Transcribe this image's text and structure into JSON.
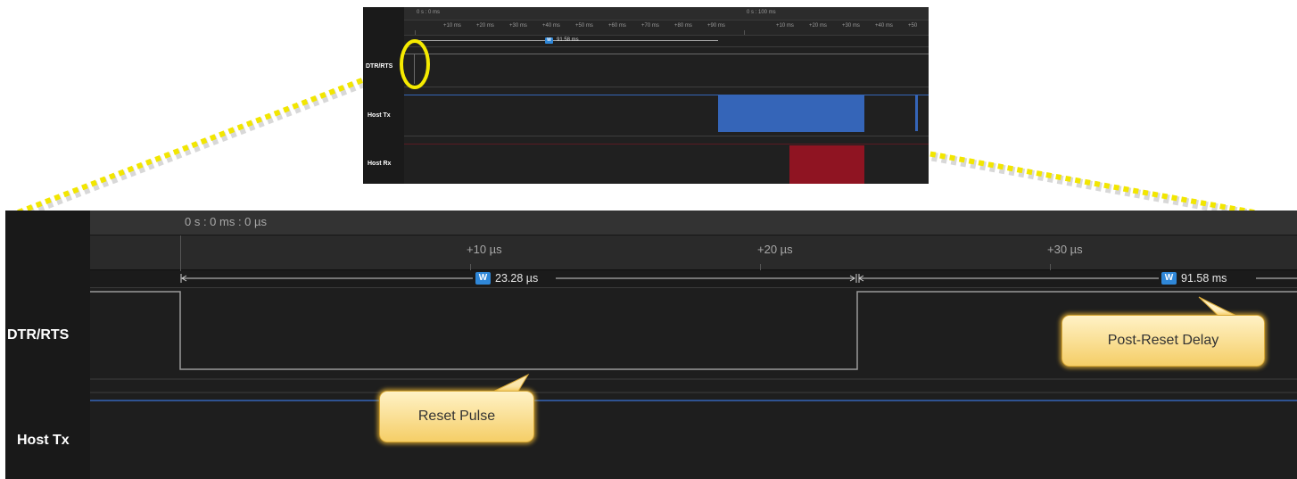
{
  "thumbnail": {
    "time_left": "0 s : 0 ms",
    "time_right": "0 s : 100 ms",
    "ticks": [
      "+10 ms",
      "+20 ms",
      "+30 ms",
      "+40 ms",
      "+50 ms",
      "+60 ms",
      "+70 ms",
      "+80 ms",
      "+90 ms",
      "+10 ms",
      "+20 ms",
      "+30 ms",
      "+40 ms",
      "+50"
    ],
    "measurement": "91.58 ms",
    "badge": "W",
    "rows": [
      "DTR/RTS",
      "Host Tx",
      "Host Rx"
    ]
  },
  "zoom": {
    "time_origin": "0 s : 0 ms : 0 µs",
    "ticks": [
      "+10 µs",
      "+20 µs",
      "+30 µs"
    ],
    "measurement_1": "23.28 µs",
    "measurement_2": "91.58 ms",
    "badge": "W",
    "rows": [
      "DTR/RTS",
      "Host Tx"
    ]
  },
  "callouts": {
    "reset_pulse": "Reset Pulse",
    "post_reset_delay": "Post-Reset Delay"
  },
  "colors": {
    "host_tx": "#3565b8",
    "host_rx": "#8f1422",
    "badge": "#2f87d8",
    "highlight": "#f5ea00",
    "callout": "#f5ce67"
  }
}
